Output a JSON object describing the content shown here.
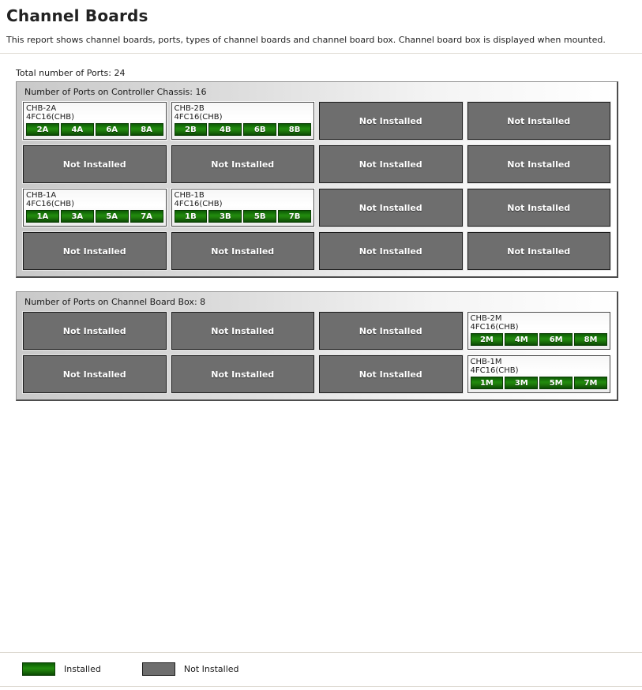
{
  "header": {
    "title": "Channel Boards",
    "description": "This report shows channel boards, ports, types of channel boards and channel board box. Channel board box is displayed when mounted."
  },
  "summary": {
    "total_ports_label": "Total number of Ports: 24"
  },
  "panels": [
    {
      "title": "Number of Ports on Controller Chassis: 16",
      "slots": [
        {
          "state": "installed",
          "name": "CHB-2A",
          "type": "4FC16(CHB)",
          "ports": [
            "2A",
            "4A",
            "6A",
            "8A"
          ]
        },
        {
          "state": "installed",
          "name": "CHB-2B",
          "type": "4FC16(CHB)",
          "ports": [
            "2B",
            "4B",
            "6B",
            "8B"
          ]
        },
        {
          "state": "not_installed",
          "label": "Not Installed"
        },
        {
          "state": "not_installed",
          "label": "Not Installed"
        },
        {
          "state": "not_installed",
          "label": "Not Installed"
        },
        {
          "state": "not_installed",
          "label": "Not Installed"
        },
        {
          "state": "not_installed",
          "label": "Not Installed"
        },
        {
          "state": "not_installed",
          "label": "Not Installed"
        },
        {
          "state": "installed",
          "name": "CHB-1A",
          "type": "4FC16(CHB)",
          "ports": [
            "1A",
            "3A",
            "5A",
            "7A"
          ]
        },
        {
          "state": "installed",
          "name": "CHB-1B",
          "type": "4FC16(CHB)",
          "ports": [
            "1B",
            "3B",
            "5B",
            "7B"
          ]
        },
        {
          "state": "not_installed",
          "label": "Not Installed"
        },
        {
          "state": "not_installed",
          "label": "Not Installed"
        },
        {
          "state": "not_installed",
          "label": "Not Installed"
        },
        {
          "state": "not_installed",
          "label": "Not Installed"
        },
        {
          "state": "not_installed",
          "label": "Not Installed"
        },
        {
          "state": "not_installed",
          "label": "Not Installed"
        }
      ]
    },
    {
      "title": "Number of Ports on Channel Board Box: 8",
      "slots": [
        {
          "state": "not_installed",
          "label": "Not Installed"
        },
        {
          "state": "not_installed",
          "label": "Not Installed"
        },
        {
          "state": "not_installed",
          "label": "Not Installed"
        },
        {
          "state": "installed",
          "name": "CHB-2M",
          "type": "4FC16(CHB)",
          "ports": [
            "2M",
            "4M",
            "6M",
            "8M"
          ]
        },
        {
          "state": "not_installed",
          "label": "Not Installed"
        },
        {
          "state": "not_installed",
          "label": "Not Installed"
        },
        {
          "state": "not_installed",
          "label": "Not Installed"
        },
        {
          "state": "installed",
          "name": "CHB-1M",
          "type": "4FC16(CHB)",
          "ports": [
            "1M",
            "3M",
            "5M",
            "7M"
          ]
        }
      ]
    }
  ],
  "legend": {
    "items": [
      {
        "label": "Installed",
        "swatch": "green",
        "color": "#1f7d0c"
      },
      {
        "label": "Not Installed",
        "swatch": "grey",
        "color": "#6e6e6e"
      }
    ]
  }
}
